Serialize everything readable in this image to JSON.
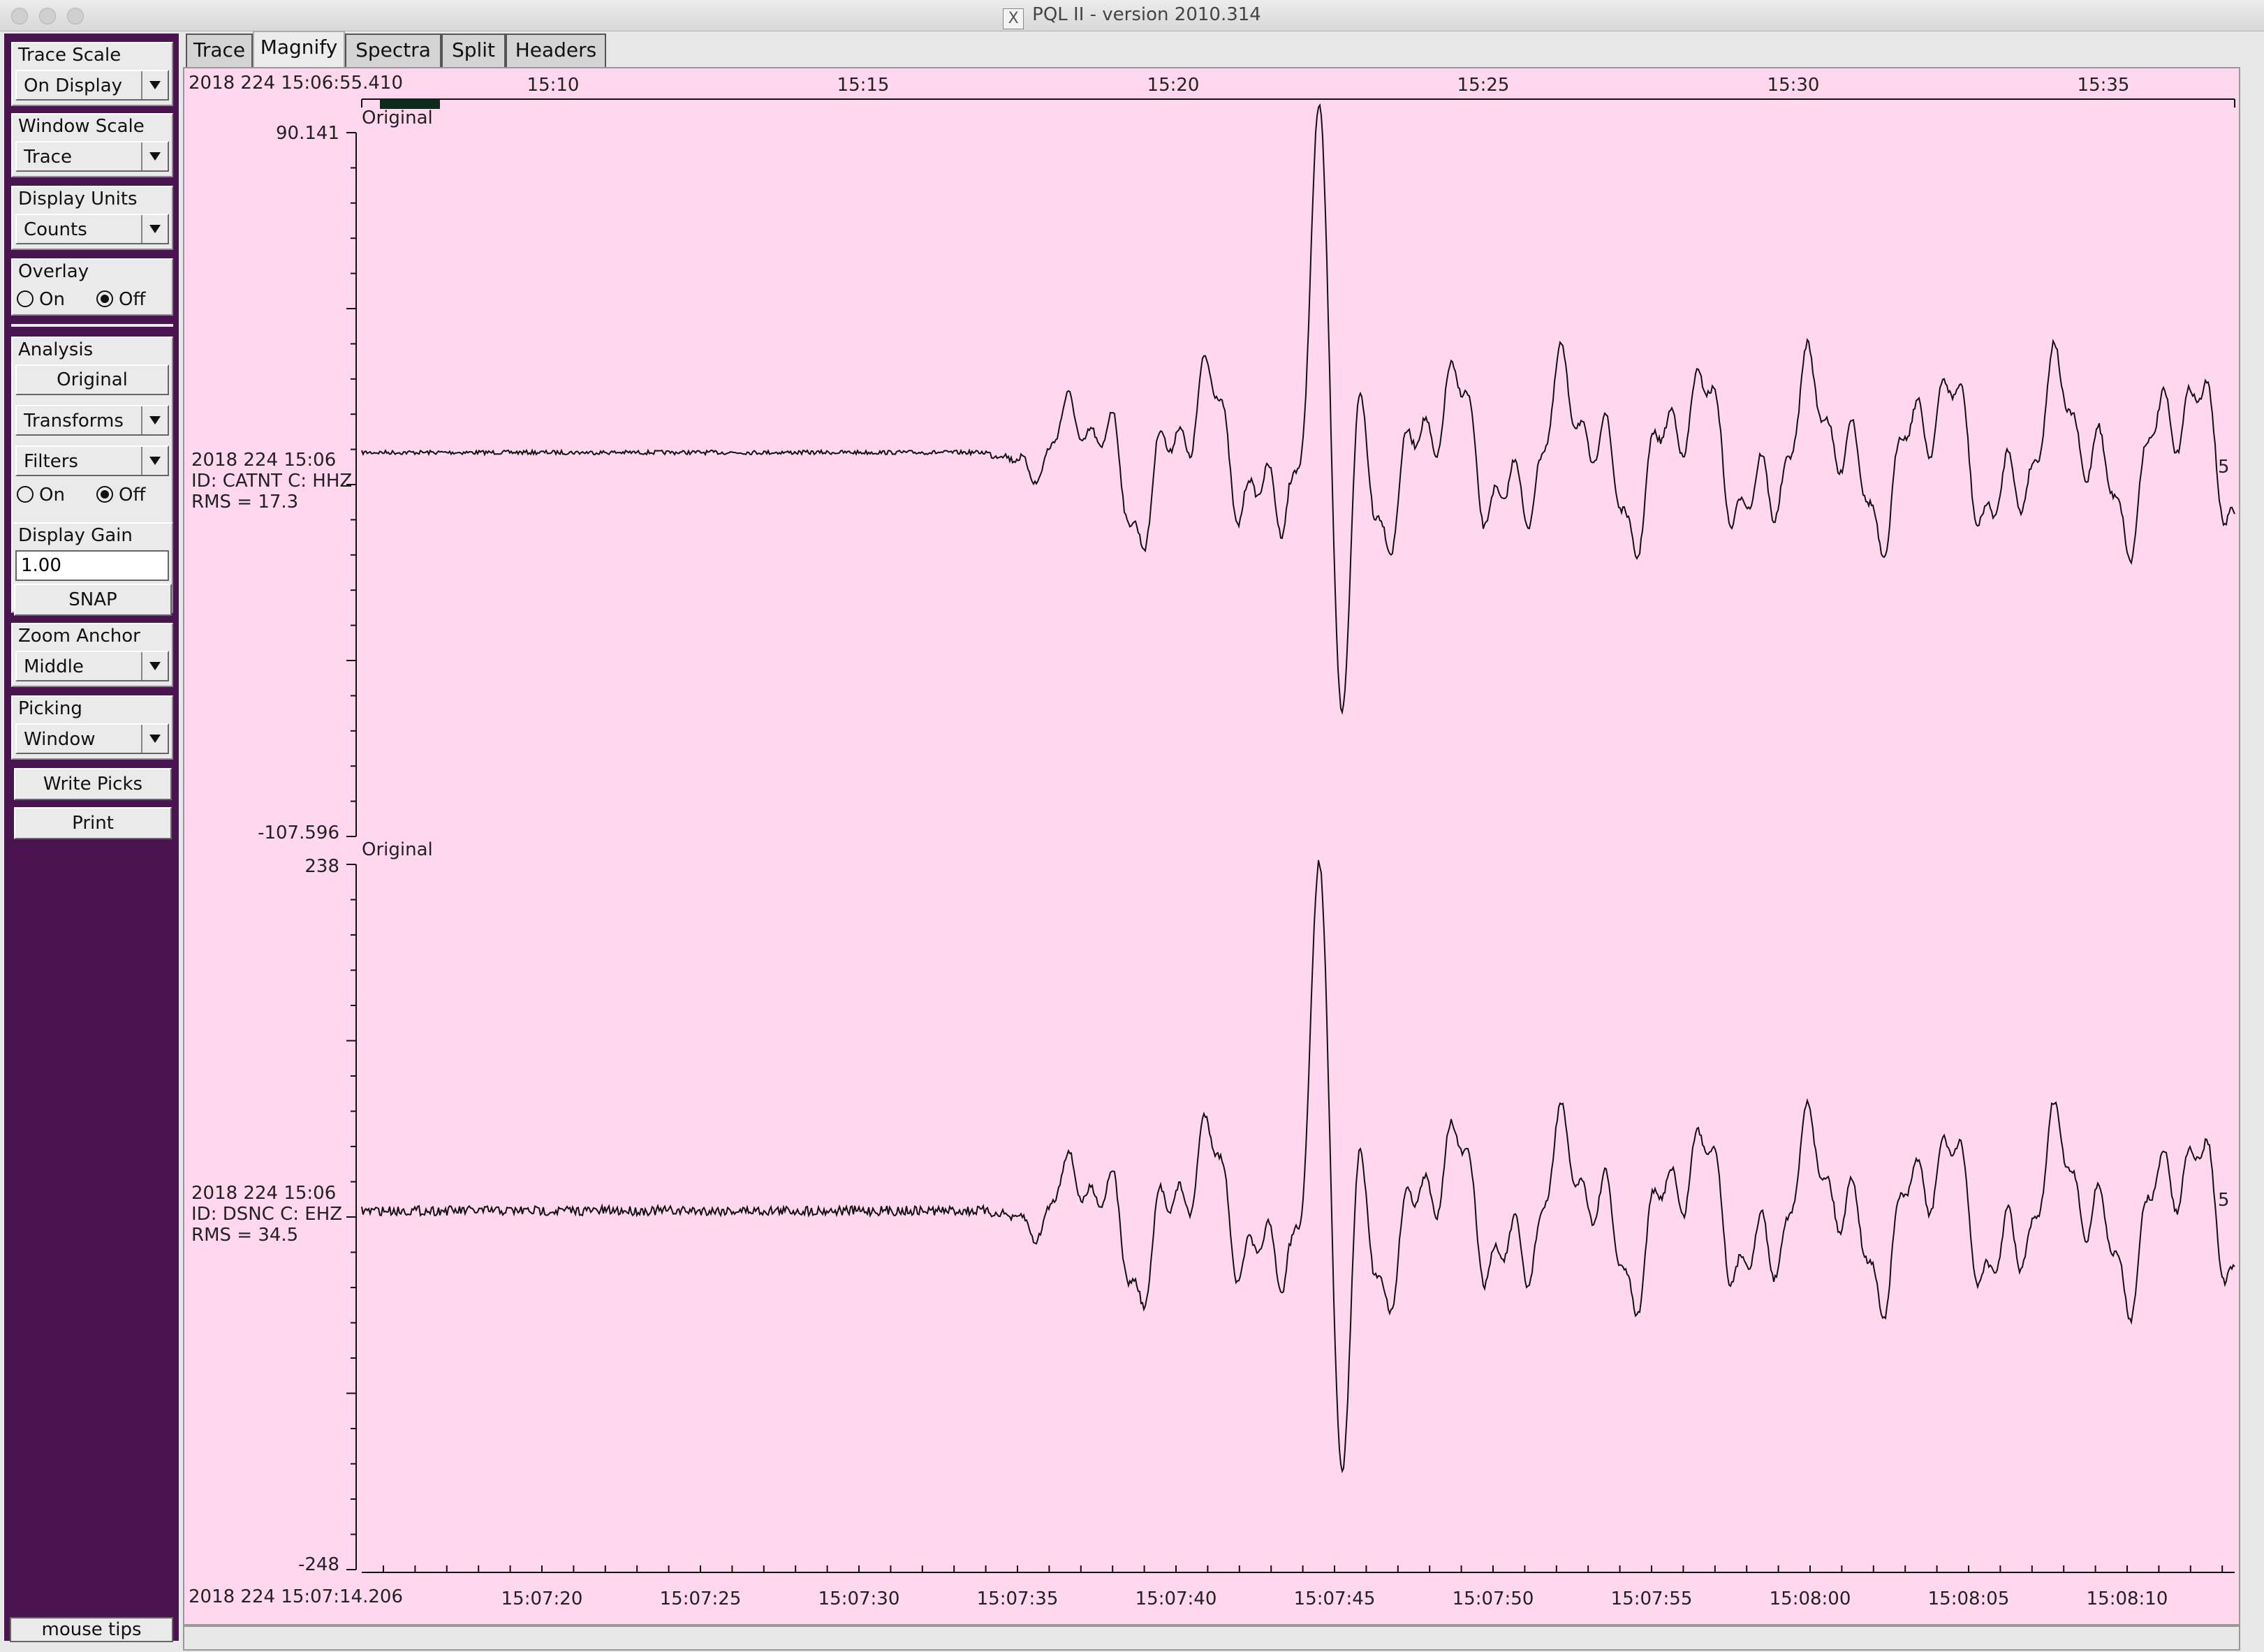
{
  "window": {
    "title": "PQL II - version 2010.314"
  },
  "tabs": [
    "Trace",
    "Magnify",
    "Spectra",
    "Split",
    "Headers"
  ],
  "active_tab": "Magnify",
  "sidebar": {
    "trace_scale": {
      "label": "Trace Scale",
      "value": "On Display"
    },
    "window_scale": {
      "label": "Window Scale",
      "value": "Trace"
    },
    "display_units": {
      "label": "Display Units",
      "value": "Counts"
    },
    "overlay": {
      "label": "Overlay",
      "on": "On",
      "off": "Off",
      "selected": "Off"
    },
    "analysis": {
      "label": "Analysis",
      "original": "Original",
      "transforms": "Transforms",
      "filters": "Filters",
      "on": "On",
      "off": "Off",
      "selected": "Off"
    },
    "display_gain": {
      "label": "Display Gain",
      "value": "1.00"
    },
    "snap": "SNAP",
    "zoom_anchor": {
      "label": "Zoom Anchor",
      "value": "Middle"
    },
    "picking": {
      "label": "Picking",
      "value": "Window"
    },
    "write_picks": "Write Picks",
    "print": "Print",
    "mouse_tips": "mouse tips"
  },
  "top_axis": {
    "start": "2018 224 15:06:55.410",
    "ticks": [
      "15:10",
      "15:15",
      "15:20",
      "15:25",
      "15:30",
      "15:35"
    ]
  },
  "bottom_axis": {
    "start": "2018 224 15:07:14.206",
    "ticks": [
      "15:07:20",
      "15:07:25",
      "15:07:30",
      "15:07:35",
      "15:07:40",
      "15:07:45",
      "15:07:50",
      "15:07:55",
      "15:08:00",
      "15:08:05",
      "15:08:10"
    ]
  },
  "traces": [
    {
      "tag": "Original",
      "ymax": "90.141",
      "ymin": "-107.596",
      "time": "2018 224 15:06",
      "id": "ID: CATNT C: HHZ",
      "rms": "RMS = 17.3",
      "right": "5"
    },
    {
      "tag": "Original",
      "ymax": "238",
      "ymin": "-248",
      "time": "2018 224 15:06",
      "id": "ID: DSNC C: EHZ",
      "rms": "RMS = 34.5",
      "right": "5"
    }
  ],
  "colors": {
    "sidebar_bg": "#4a1450",
    "plot_bg": "#ffd8ef",
    "trace": "#111111"
  }
}
